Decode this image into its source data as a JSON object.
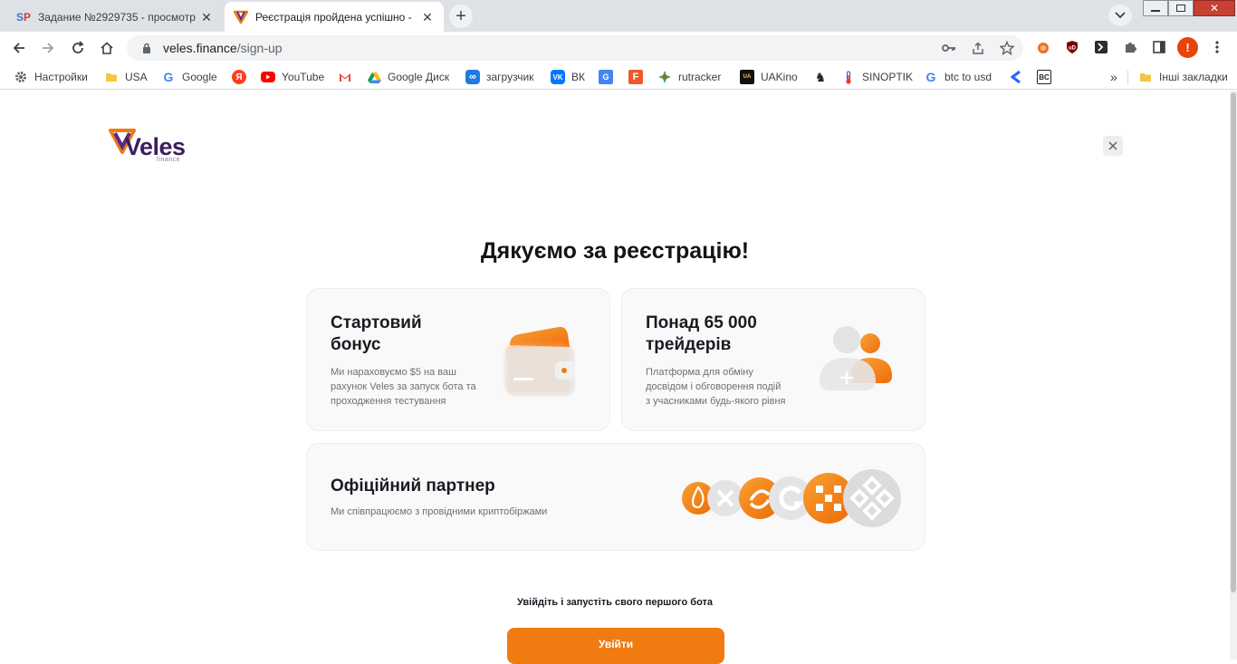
{
  "browser": {
    "tabs": [
      {
        "title": "Задание №2929735 - просмотр",
        "favicon": "sp-icon"
      },
      {
        "title": "Реєстрація пройдена успішно -",
        "favicon": "veles-icon"
      }
    ],
    "url_host": "veles.finance",
    "url_path": "/sign-up",
    "profile_badge": "!",
    "bookmarks": [
      {
        "label": "Настройки",
        "icon": "gear-icon"
      },
      {
        "label": "USA",
        "icon": "folder-icon"
      },
      {
        "label": "Google",
        "icon": "google-icon"
      },
      {
        "label": "",
        "icon": "yandex-icon"
      },
      {
        "label": "YouTube",
        "icon": "youtube-icon"
      },
      {
        "label": "",
        "icon": "gmail-icon"
      },
      {
        "label": "Google Диск",
        "icon": "drive-icon"
      },
      {
        "label": "загрузчик",
        "icon": "loader-icon"
      },
      {
        "label": "ВК",
        "icon": "vk-icon"
      },
      {
        "label": "",
        "icon": "translate-icon"
      },
      {
        "label": "",
        "icon": "f-icon"
      },
      {
        "label": "rutracker",
        "icon": "rutracker-icon"
      },
      {
        "label": "UAKino",
        "icon": "uakino-icon"
      },
      {
        "label": "",
        "icon": "chess-icon"
      },
      {
        "label": "SINOPTIK",
        "icon": "thermometer-icon"
      },
      {
        "label": "btc to usd",
        "icon": "google-icon"
      },
      {
        "label": "",
        "icon": "arrow-icon"
      },
      {
        "label": "",
        "icon": "bc-icon"
      }
    ],
    "bookmarks_more": "»",
    "other_bookmarks": "Інші закладки",
    "bc_text": "BC"
  },
  "page": {
    "logo_text": "Veles",
    "logo_sub": "finance",
    "heading": "Дякуємо за реєстрацію!",
    "cards": [
      {
        "title_line1": "Стартовий",
        "title_line2": "бонус",
        "text_line1": "Ми нараховуємо $5 на ваш",
        "text_line2": "рахунок Veles за запуск бота та",
        "text_line3": "проходження тестування",
        "icon": "wallet-icon"
      },
      {
        "title_line1": "Понад 65 000",
        "title_line2": "трейдерів",
        "text_line1": "Платформа для обміну",
        "text_line2": "досвідом і обговорення подій",
        "text_line3": "з учасниками будь-якого рівня",
        "icon": "users-icon"
      },
      {
        "title_line1": "Офіційний партнер",
        "text_line1": "Ми співпрацюємо з провідними криптобіржами",
        "icon": "exchanges-icon"
      }
    ],
    "cta_caption": "Увійдіть і запустіть свого першого бота",
    "cta_button": "Увійти"
  },
  "colors": {
    "accent": "#ef7b11",
    "brand_purple": "#3a1f5d",
    "card_bg": "#f9f9f9"
  }
}
